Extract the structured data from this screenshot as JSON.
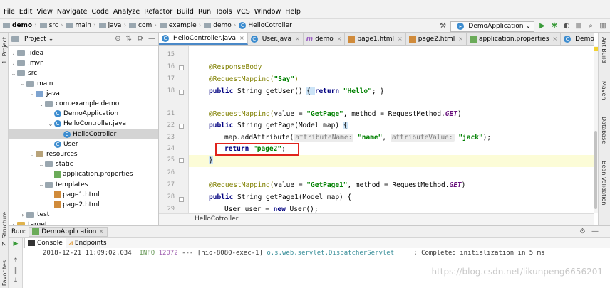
{
  "menu": [
    "File",
    "Edit",
    "View",
    "Navigate",
    "Code",
    "Analyze",
    "Refactor",
    "Build",
    "Run",
    "Tools",
    "VCS",
    "Window",
    "Help"
  ],
  "nav": {
    "crumbs": [
      "demo",
      "src",
      "main",
      "java",
      "com",
      "example",
      "demo",
      "HelloCotroller"
    ],
    "run_config": "DemoApplication"
  },
  "project": {
    "title": "Project",
    "nodes": [
      {
        "label": ".idea",
        "depth": 1,
        "arrow": "›",
        "icon": "folder"
      },
      {
        "label": ".mvn",
        "depth": 1,
        "arrow": "›",
        "icon": "folder"
      },
      {
        "label": "src",
        "depth": 1,
        "arrow": "⌄",
        "icon": "folder"
      },
      {
        "label": "main",
        "depth": 2,
        "arrow": "⌄",
        "icon": "folder"
      },
      {
        "label": "java",
        "depth": 3,
        "arrow": "⌄",
        "icon": "src"
      },
      {
        "label": "com.example.demo",
        "depth": 4,
        "arrow": "⌄",
        "icon": "pkg"
      },
      {
        "label": "DemoApplication",
        "depth": 5,
        "arrow": "",
        "icon": "class"
      },
      {
        "label": "HelloController.java",
        "depth": 5,
        "arrow": "⌄",
        "icon": "class"
      },
      {
        "label": "HelloCotroller",
        "depth": 6,
        "arrow": "",
        "icon": "class",
        "selected": true
      },
      {
        "label": "User",
        "depth": 5,
        "arrow": "",
        "icon": "class"
      },
      {
        "label": "resources",
        "depth": 3,
        "arrow": "⌄",
        "icon": "res"
      },
      {
        "label": "static",
        "depth": 4,
        "arrow": "⌄",
        "icon": "folder"
      },
      {
        "label": "application.properties",
        "depth": 5,
        "arrow": "",
        "icon": "leaf"
      },
      {
        "label": "templates",
        "depth": 4,
        "arrow": "⌄",
        "icon": "folder"
      },
      {
        "label": "page1.html",
        "depth": 5,
        "arrow": "",
        "icon": "html"
      },
      {
        "label": "page2.html",
        "depth": 5,
        "arrow": "",
        "icon": "html"
      },
      {
        "label": "test",
        "depth": 2,
        "arrow": "›",
        "icon": "folder"
      },
      {
        "label": "target",
        "depth": 1,
        "arrow": "›",
        "icon": "tgt"
      }
    ]
  },
  "tabs": [
    {
      "label": "HelloController.java",
      "icon": "class",
      "active": true
    },
    {
      "label": "User.java",
      "icon": "class"
    },
    {
      "label": "demo",
      "icon": "m"
    },
    {
      "label": "page1.html",
      "icon": "html"
    },
    {
      "label": "page2.html",
      "icon": "html"
    },
    {
      "label": "application.properties",
      "icon": "leaf"
    },
    {
      "label": "DemoApplication.java",
      "icon": "class"
    }
  ],
  "editor": {
    "line_numbers": [
      "15",
      "16",
      "17",
      "18",
      "21",
      "22",
      "23",
      "24",
      "25",
      "26",
      "27",
      "28",
      "29",
      "30"
    ],
    "line_16": "@ResponseBody",
    "line_17_a": "@RequestMapping(",
    "line_17_b": "\"Say\"",
    "line_17_c": ")",
    "line_18_kw": "public",
    "line_18_a": " String getUser() ",
    "line_18_b": "{ ",
    "line_18_kw2": "return",
    "line_18_str": " \"Hello\"",
    "line_18_c": "; }",
    "line_22_a": "@RequestMapping(",
    "line_22_b": "value = ",
    "line_22_str": "\"GetPage\"",
    "line_22_c": ", method = RequestMethod.",
    "line_22_it": "GET",
    "line_22_d": ")",
    "line_23_kw": "public",
    "line_23_a": " String getPage(Model map) ",
    "line_23_b": "{",
    "line_24_a": "map.addAttribute(",
    "line_24_h1": "attributeName:",
    "line_24_s1": " \"name\"",
    "line_24_b": ", ",
    "line_24_h2": "attributeValue:",
    "line_24_s2": " \"jack\"",
    "line_24_c": ");",
    "line_25_kw": "return",
    "line_25_str": " \"page2\"",
    "line_25_c": ";",
    "line_26": "}",
    "line_28_a": "@RequestMapping(",
    "line_28_b": "value = ",
    "line_28_str": "\"GetPage1\"",
    "line_28_c": ", method = RequestMethod.",
    "line_28_it": "GET",
    "line_28_d": ")",
    "line_29_kw": "public",
    "line_29_a": " String getPage1(Model map) {",
    "line_30_a": "User user = ",
    "line_30_kw": "new",
    "line_30_b": " User();",
    "breadcrumb": "HelloCotroller"
  },
  "side_right": [
    "Ant Build",
    "Maven",
    "Database",
    "Bean Validation"
  ],
  "side_left": [
    "1: Project",
    "Z: Structure",
    "2: Favorites"
  ],
  "run": {
    "label": "Run:",
    "tab": "DemoApplication",
    "subtabs": [
      "Console",
      "Endpoints"
    ],
    "log_time": "2018-12-21 11:09:02.034",
    "log_level": "INFO",
    "log_pid": "12072",
    "log_sep": "---",
    "log_thread": "[nio-8080-exec-1]",
    "log_class": "o.s.web.servlet.DispatcherServlet",
    "log_msg": ": Completed initialization in 5 ms"
  },
  "watermark": "https://blog.csdn.net/likunpeng6656201"
}
